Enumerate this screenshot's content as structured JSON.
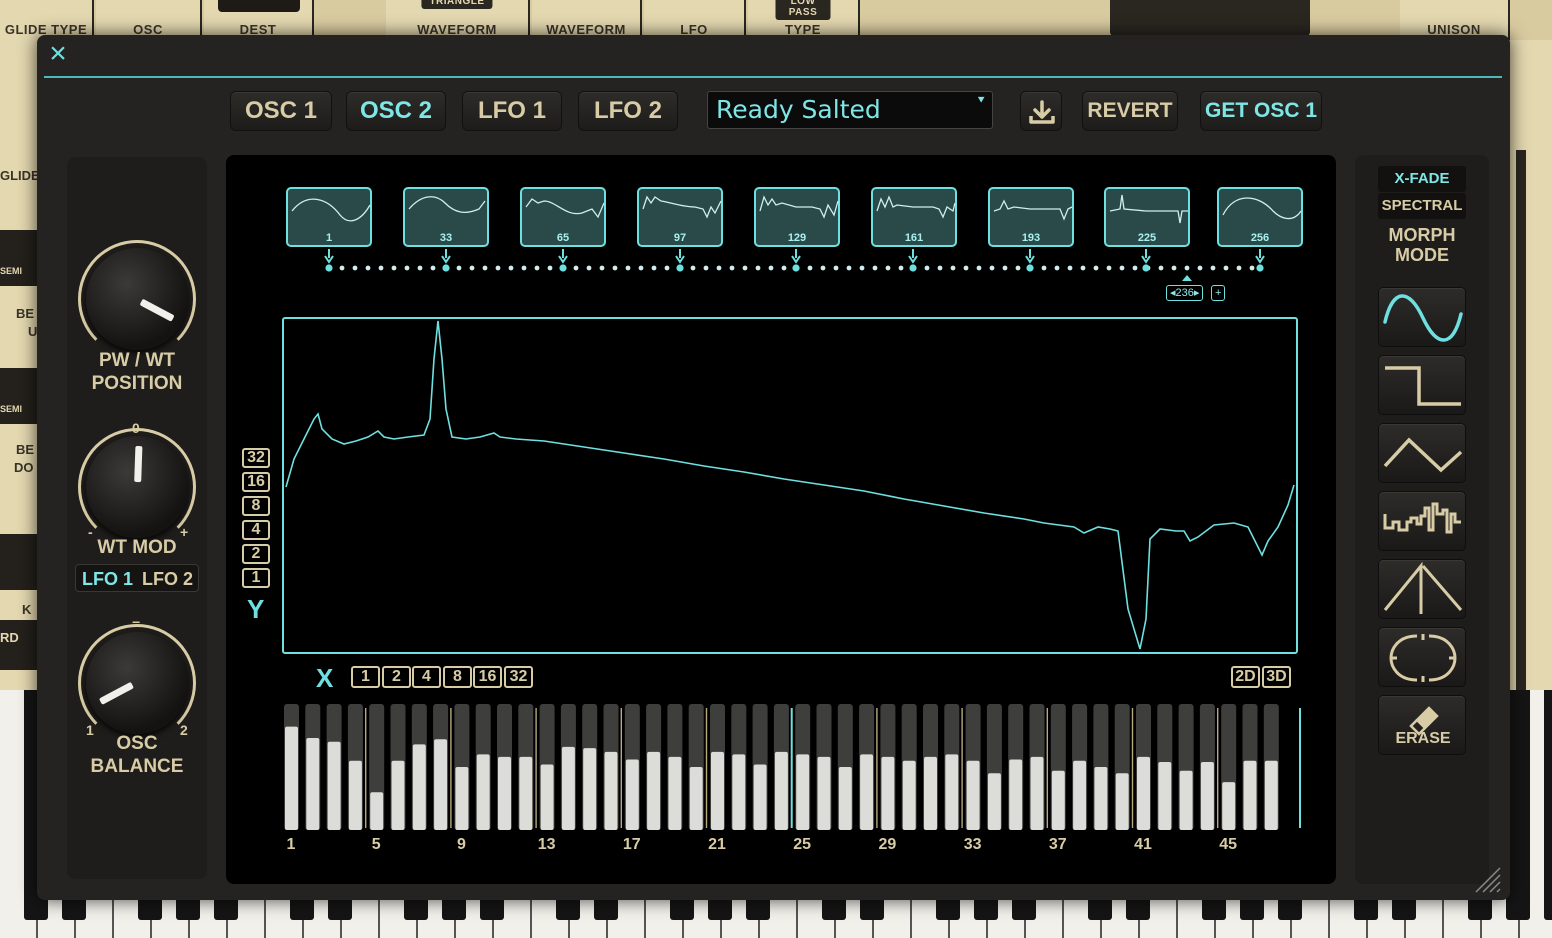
{
  "background": {
    "top_labels": [
      "GLIDE TYPE",
      "OSC",
      "DEST",
      "WAVEFORM",
      "WAVEFORM",
      "LFO",
      "TYPE"
    ],
    "top_tags": [
      "TRIANGLE",
      "LOW PASS"
    ],
    "right_label": "UNISON",
    "left_fragments": [
      "GLIDE",
      "SEMI",
      "BE",
      "U",
      "SEMI",
      "BE",
      "DO",
      "K",
      "RD"
    ]
  },
  "header": {
    "close_icon": "×",
    "tabs": [
      {
        "label": "OSC 1",
        "active": false
      },
      {
        "label": "OSC 2",
        "active": true
      },
      {
        "label": "LFO 1",
        "active": false
      },
      {
        "label": "LFO 2",
        "active": false
      }
    ],
    "preset_name": "Ready Salted",
    "save_icon": "download-icon",
    "revert_label": "REVERT",
    "get_osc_label": "GET OSC 1"
  },
  "left": {
    "pw_wt_label_1": "PW / WT",
    "pw_wt_label_2": "POSITION",
    "wt_mod_label": "WT MOD",
    "wt_mod_zero": "0",
    "wt_mod_minus": "-",
    "wt_mod_plus": "+",
    "lfo1": "LFO 1",
    "lfo2": "LFO 2",
    "osc_balance_1": "OSC",
    "osc_balance_2": "BALANCE",
    "osc_mark_1": "1",
    "osc_mark_2": "2",
    "osc_mark_mid": "="
  },
  "display": {
    "thumbs": [
      "1",
      "33",
      "65",
      "97",
      "129",
      "161",
      "193",
      "225",
      "256"
    ],
    "position_readout": "◂236▸",
    "add_icon": "+",
    "y_axis_letter": "Y",
    "y_buttons": [
      "32",
      "16",
      "8",
      "4",
      "2",
      "1"
    ],
    "x_axis_letter": "X",
    "x_buttons": [
      "1",
      "2",
      "4",
      "8",
      "16",
      "32"
    ],
    "view_2d": "2D",
    "view_3d": "3D",
    "harmonic_labels": [
      "1",
      "5",
      "9",
      "13",
      "17",
      "21",
      "25",
      "29",
      "33",
      "37",
      "41",
      "45"
    ],
    "harmonic_levels": [
      0.82,
      0.73,
      0.7,
      0.55,
      0.3,
      0.55,
      0.68,
      0.72,
      0.5,
      0.6,
      0.58,
      0.58,
      0.52,
      0.66,
      0.65,
      0.62,
      0.56,
      0.62,
      0.58,
      0.5,
      0.62,
      0.6,
      0.52,
      0.62,
      0.6,
      0.58,
      0.5,
      0.6,
      0.58,
      0.55,
      0.58,
      0.6,
      0.55,
      0.45,
      0.56,
      0.58,
      0.47,
      0.55,
      0.5,
      0.45,
      0.58,
      0.54,
      0.47,
      0.54,
      0.38,
      0.55,
      0.55
    ],
    "accent": "#6fe0e0",
    "cream": "#d8cca6"
  },
  "right": {
    "xfade_label": "X-FADE",
    "spectral_label": "SPECTRAL",
    "morph_label_1": "MORPH",
    "morph_label_2": "MODE",
    "wave_icons": [
      "sine-wave-icon",
      "square-wave-icon",
      "triangle-wave-icon",
      "random-wave-icon",
      "saw-wave-icon",
      "normalize-icon"
    ],
    "erase_label": "ERASE"
  }
}
